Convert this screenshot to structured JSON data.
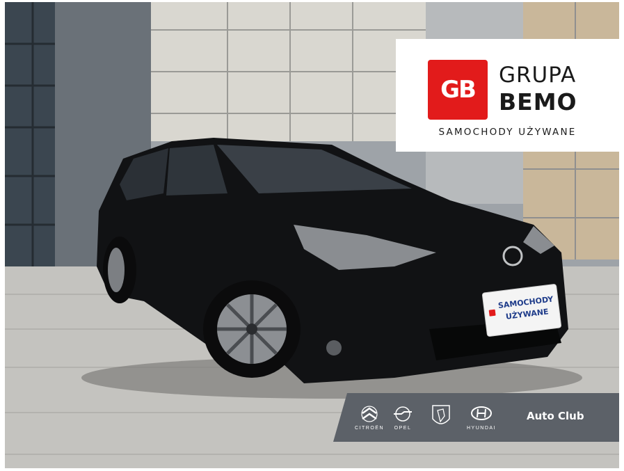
{
  "photo": {
    "subject": "toyota-car",
    "colors": {
      "car": "#111214",
      "pavement": "#c4c3bf",
      "building": "#8a8f95"
    }
  },
  "logo": {
    "mark": "GB",
    "line1": "GRUPA",
    "line2": "BEMO",
    "tagline": "SAMOCHODY UŻYWANE",
    "mark_color": "#e21b1b"
  },
  "plate": {
    "line1": "SAMOCHODY",
    "line2": "UŻYWANE"
  },
  "brand_bar": {
    "items": [
      {
        "name": "citroen",
        "label": "CITROËN"
      },
      {
        "name": "opel",
        "label": "OPEL"
      },
      {
        "name": "peugeot",
        "label": ""
      },
      {
        "name": "hyundai",
        "label": "HYUNDAI"
      }
    ],
    "auto_club": "Auto Club",
    "color": "#5c6168"
  }
}
